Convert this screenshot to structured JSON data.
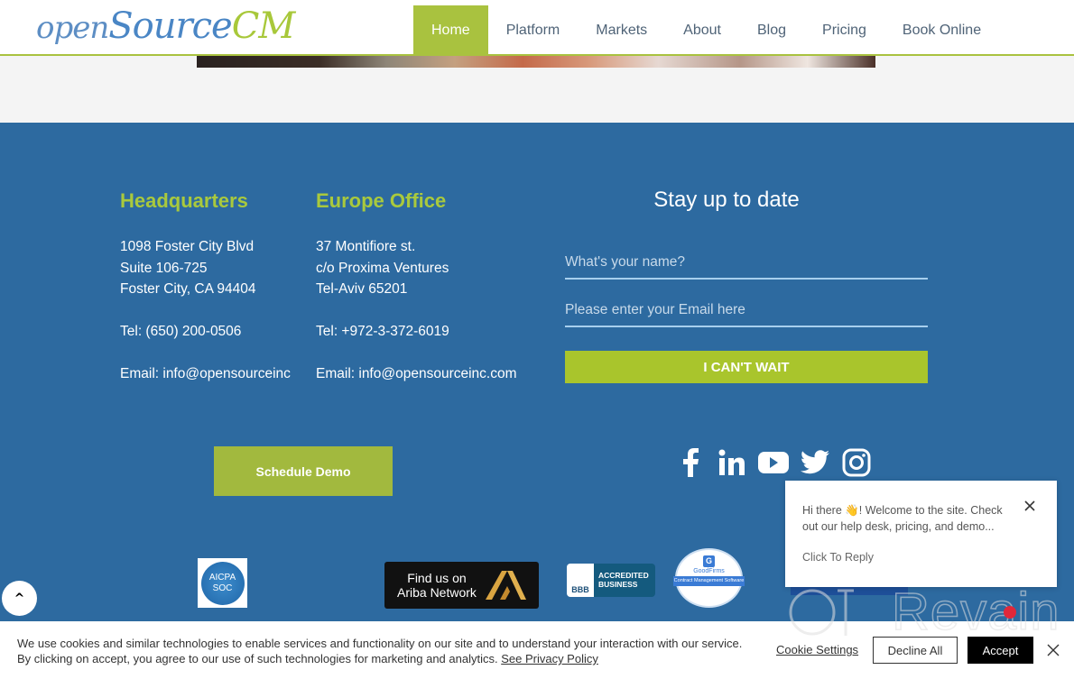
{
  "header": {
    "logo": {
      "part1": "open",
      "part2": "Source",
      "part3": "CM"
    },
    "nav": [
      {
        "label": "Home",
        "active": true
      },
      {
        "label": "Platform",
        "active": false
      },
      {
        "label": "Markets",
        "active": false
      },
      {
        "label": "About",
        "active": false
      },
      {
        "label": "Blog",
        "active": false
      },
      {
        "label": "Pricing",
        "active": false
      },
      {
        "label": "Book Online",
        "active": false
      }
    ]
  },
  "footer": {
    "headquarters": {
      "title": "Headquarters",
      "address": [
        "1098 Foster City Blvd",
        "Suite 106-725",
        "Foster City, CA 94404"
      ],
      "tel": "Tel: (650) 200-0506",
      "email": "Email: info@opensourceinc"
    },
    "europe": {
      "title": "Europe Office",
      "address": [
        "37 Montifiore st.",
        "c/o Proxima Ventures",
        "Tel-Aviv 65201"
      ],
      "tel": "Tel: +972-3-372-6019",
      "email": "Email: info@opensourceinc.com"
    },
    "newsletter": {
      "title": "Stay up to date",
      "name_placeholder": "What's your name?",
      "email_placeholder": "Please enter your Email here",
      "name_value": "",
      "email_value": "",
      "submit_label": "I CAN'T WAIT"
    },
    "schedule_demo_label": "Schedule Demo",
    "socials": [
      "facebook-icon",
      "linkedin-icon",
      "youtube-icon",
      "twitter-icon",
      "instagram-icon"
    ],
    "badges": {
      "aicpa": {
        "line1": "AICPA",
        "line2": "SOC"
      },
      "ariba": {
        "line1": "Find us on",
        "line2": "Ariba Network"
      },
      "bbb": {
        "left": "BBB",
        "line1": "ACCREDITED",
        "line2": "BUSINESS"
      },
      "goodfirms": {
        "logo": "G",
        "name": "GoodFirms",
        "ribbon": "Contract Management Software"
      }
    }
  },
  "chat": {
    "message": "Hi there 👋! Welcome to the site. Check out our help desk, pricing, and demo...",
    "reply_label": "Click To Reply"
  },
  "watermark": {
    "text": "Revain"
  },
  "cookie": {
    "line1": "We use cookies and similar technologies to enable services and functionality on our site and to understand your interaction with our service.",
    "line2": "By clicking on accept, you agree to our use of such technologies for marketing and analytics.",
    "policy_link": "See Privacy Policy",
    "settings_label": "Cookie Settings",
    "decline_label": "Decline All",
    "accept_label": "Accept"
  },
  "colors": {
    "brand_green": "#a9c23f",
    "footer_blue": "#2d6aa0",
    "heading_green": "#a9c93d"
  }
}
